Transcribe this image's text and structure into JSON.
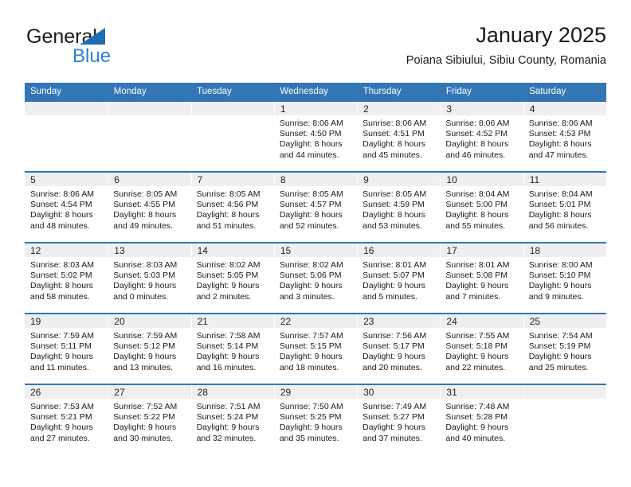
{
  "brand": {
    "name_part1": "General",
    "name_part2": "Blue",
    "triangle_color": "#1f6eb5",
    "blue_color": "#2b82d4"
  },
  "header": {
    "title": "January 2025",
    "subtitle": "Poiana Sibiului, Sibiu County, Romania"
  },
  "theme": {
    "header_blue": "#3276b5",
    "daynum_band": "#efefef",
    "text": "#1a1a1a"
  },
  "calendar": {
    "weekday_headers": [
      "Sunday",
      "Monday",
      "Tuesday",
      "Wednesday",
      "Thursday",
      "Friday",
      "Saturday"
    ],
    "weeks": [
      [
        {
          "day": "",
          "lines": []
        },
        {
          "day": "",
          "lines": []
        },
        {
          "day": "",
          "lines": []
        },
        {
          "day": "1",
          "lines": [
            "Sunrise: 8:06 AM",
            "Sunset: 4:50 PM",
            "Daylight: 8 hours",
            "and 44 minutes."
          ]
        },
        {
          "day": "2",
          "lines": [
            "Sunrise: 8:06 AM",
            "Sunset: 4:51 PM",
            "Daylight: 8 hours",
            "and 45 minutes."
          ]
        },
        {
          "day": "3",
          "lines": [
            "Sunrise: 8:06 AM",
            "Sunset: 4:52 PM",
            "Daylight: 8 hours",
            "and 46 minutes."
          ]
        },
        {
          "day": "4",
          "lines": [
            "Sunrise: 8:06 AM",
            "Sunset: 4:53 PM",
            "Daylight: 8 hours",
            "and 47 minutes."
          ]
        }
      ],
      [
        {
          "day": "5",
          "lines": [
            "Sunrise: 8:06 AM",
            "Sunset: 4:54 PM",
            "Daylight: 8 hours",
            "and 48 minutes."
          ]
        },
        {
          "day": "6",
          "lines": [
            "Sunrise: 8:05 AM",
            "Sunset: 4:55 PM",
            "Daylight: 8 hours",
            "and 49 minutes."
          ]
        },
        {
          "day": "7",
          "lines": [
            "Sunrise: 8:05 AM",
            "Sunset: 4:56 PM",
            "Daylight: 8 hours",
            "and 51 minutes."
          ]
        },
        {
          "day": "8",
          "lines": [
            "Sunrise: 8:05 AM",
            "Sunset: 4:57 PM",
            "Daylight: 8 hours",
            "and 52 minutes."
          ]
        },
        {
          "day": "9",
          "lines": [
            "Sunrise: 8:05 AM",
            "Sunset: 4:59 PM",
            "Daylight: 8 hours",
            "and 53 minutes."
          ]
        },
        {
          "day": "10",
          "lines": [
            "Sunrise: 8:04 AM",
            "Sunset: 5:00 PM",
            "Daylight: 8 hours",
            "and 55 minutes."
          ]
        },
        {
          "day": "11",
          "lines": [
            "Sunrise: 8:04 AM",
            "Sunset: 5:01 PM",
            "Daylight: 8 hours",
            "and 56 minutes."
          ]
        }
      ],
      [
        {
          "day": "12",
          "lines": [
            "Sunrise: 8:03 AM",
            "Sunset: 5:02 PM",
            "Daylight: 8 hours",
            "and 58 minutes."
          ]
        },
        {
          "day": "13",
          "lines": [
            "Sunrise: 8:03 AM",
            "Sunset: 5:03 PM",
            "Daylight: 9 hours",
            "and 0 minutes."
          ]
        },
        {
          "day": "14",
          "lines": [
            "Sunrise: 8:02 AM",
            "Sunset: 5:05 PM",
            "Daylight: 9 hours",
            "and 2 minutes."
          ]
        },
        {
          "day": "15",
          "lines": [
            "Sunrise: 8:02 AM",
            "Sunset: 5:06 PM",
            "Daylight: 9 hours",
            "and 3 minutes."
          ]
        },
        {
          "day": "16",
          "lines": [
            "Sunrise: 8:01 AM",
            "Sunset: 5:07 PM",
            "Daylight: 9 hours",
            "and 5 minutes."
          ]
        },
        {
          "day": "17",
          "lines": [
            "Sunrise: 8:01 AM",
            "Sunset: 5:08 PM",
            "Daylight: 9 hours",
            "and 7 minutes."
          ]
        },
        {
          "day": "18",
          "lines": [
            "Sunrise: 8:00 AM",
            "Sunset: 5:10 PM",
            "Daylight: 9 hours",
            "and 9 minutes."
          ]
        }
      ],
      [
        {
          "day": "19",
          "lines": [
            "Sunrise: 7:59 AM",
            "Sunset: 5:11 PM",
            "Daylight: 9 hours",
            "and 11 minutes."
          ]
        },
        {
          "day": "20",
          "lines": [
            "Sunrise: 7:59 AM",
            "Sunset: 5:12 PM",
            "Daylight: 9 hours",
            "and 13 minutes."
          ]
        },
        {
          "day": "21",
          "lines": [
            "Sunrise: 7:58 AM",
            "Sunset: 5:14 PM",
            "Daylight: 9 hours",
            "and 16 minutes."
          ]
        },
        {
          "day": "22",
          "lines": [
            "Sunrise: 7:57 AM",
            "Sunset: 5:15 PM",
            "Daylight: 9 hours",
            "and 18 minutes."
          ]
        },
        {
          "day": "23",
          "lines": [
            "Sunrise: 7:56 AM",
            "Sunset: 5:17 PM",
            "Daylight: 9 hours",
            "and 20 minutes."
          ]
        },
        {
          "day": "24",
          "lines": [
            "Sunrise: 7:55 AM",
            "Sunset: 5:18 PM",
            "Daylight: 9 hours",
            "and 22 minutes."
          ]
        },
        {
          "day": "25",
          "lines": [
            "Sunrise: 7:54 AM",
            "Sunset: 5:19 PM",
            "Daylight: 9 hours",
            "and 25 minutes."
          ]
        }
      ],
      [
        {
          "day": "26",
          "lines": [
            "Sunrise: 7:53 AM",
            "Sunset: 5:21 PM",
            "Daylight: 9 hours",
            "and 27 minutes."
          ]
        },
        {
          "day": "27",
          "lines": [
            "Sunrise: 7:52 AM",
            "Sunset: 5:22 PM",
            "Daylight: 9 hours",
            "and 30 minutes."
          ]
        },
        {
          "day": "28",
          "lines": [
            "Sunrise: 7:51 AM",
            "Sunset: 5:24 PM",
            "Daylight: 9 hours",
            "and 32 minutes."
          ]
        },
        {
          "day": "29",
          "lines": [
            "Sunrise: 7:50 AM",
            "Sunset: 5:25 PM",
            "Daylight: 9 hours",
            "and 35 minutes."
          ]
        },
        {
          "day": "30",
          "lines": [
            "Sunrise: 7:49 AM",
            "Sunset: 5:27 PM",
            "Daylight: 9 hours",
            "and 37 minutes."
          ]
        },
        {
          "day": "31",
          "lines": [
            "Sunrise: 7:48 AM",
            "Sunset: 5:28 PM",
            "Daylight: 9 hours",
            "and 40 minutes."
          ]
        },
        {
          "day": "",
          "lines": []
        }
      ]
    ]
  }
}
